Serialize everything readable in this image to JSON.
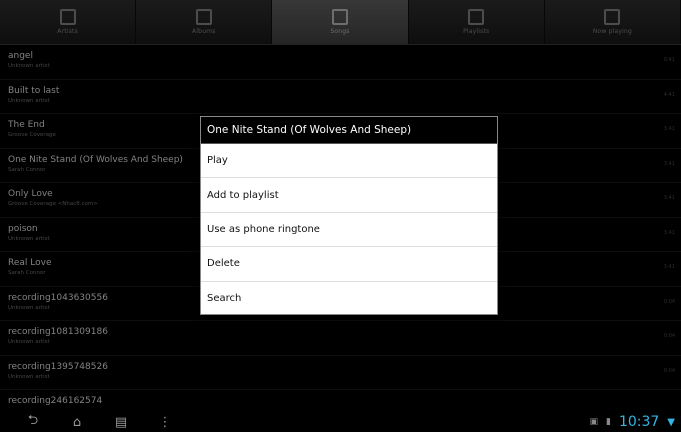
{
  "tabs": [
    {
      "label": "Artists",
      "icon": "artists-icon",
      "active": false
    },
    {
      "label": "Albums",
      "icon": "albums-icon",
      "active": false
    },
    {
      "label": "Songs",
      "icon": "songs-icon",
      "active": true
    },
    {
      "label": "Playlists",
      "icon": "playlists-icon",
      "active": false
    },
    {
      "label": "Now playing",
      "icon": "now-playing-icon",
      "active": false
    }
  ],
  "songs": [
    {
      "title": "angel",
      "artist": "Unknown artist",
      "duration": "0:41"
    },
    {
      "title": "Built to last",
      "artist": "Unknown artist",
      "duration": "4:41"
    },
    {
      "title": "The End",
      "artist": "Groove Coverage",
      "duration": "3:41"
    },
    {
      "title": "One Nite Stand (Of Wolves And Sheep)",
      "artist": "Sarah Connor",
      "duration": "3:41"
    },
    {
      "title": "Only Love",
      "artist": "Groove Coverage <Nhac8.com>",
      "duration": "3:41"
    },
    {
      "title": "poison",
      "artist": "Unknown artist",
      "duration": "3:41"
    },
    {
      "title": "Real Love",
      "artist": "Sarah Connor",
      "duration": "3:41"
    },
    {
      "title": "recording1043630556",
      "artist": "Unknown artist",
      "duration": "0:04"
    },
    {
      "title": "recording1081309186",
      "artist": "Unknown artist",
      "duration": "0:04"
    },
    {
      "title": "recording1395748526",
      "artist": "Unknown artist",
      "duration": "0:04"
    },
    {
      "title": "recording246162574",
      "artist": "",
      "duration": ""
    }
  ],
  "dialog": {
    "title": "One Nite Stand (Of Wolves And Sheep)",
    "items": [
      "Play",
      "Add to playlist",
      "Use as phone ringtone",
      "Delete",
      "Search"
    ]
  },
  "systembar": {
    "clock": "10:37",
    "nav": [
      "back-icon",
      "home-icon",
      "recent-apps-icon",
      "menu-icon"
    ]
  }
}
